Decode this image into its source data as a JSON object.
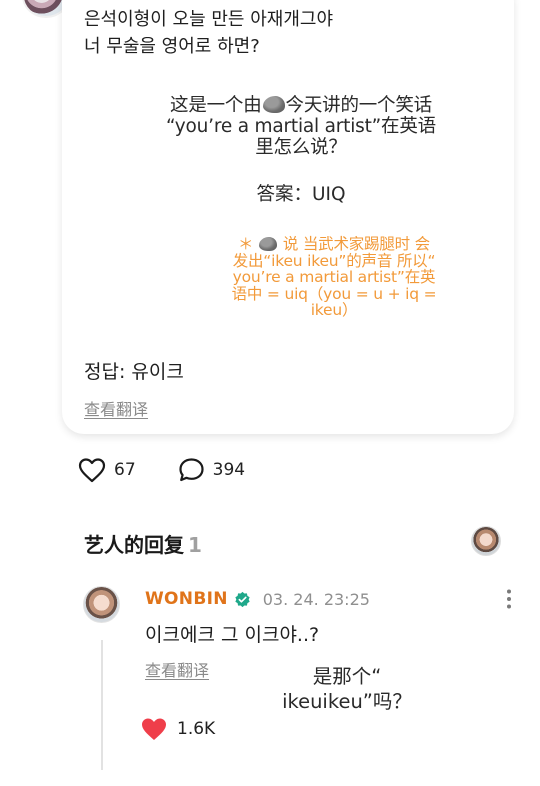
{
  "post": {
    "text_lines": [
      "은석이형이 오늘 만든 아재개그야",
      "너 무술을 영어로 하면?"
    ],
    "cn_question": {
      "before_rock": "这是一个由",
      "after_rock": "今天讲的一个笑话",
      "line2": "“you’re a martial artist”在英语",
      "line3": "里怎么说？"
    },
    "answer": "答案：UIQ",
    "note": {
      "star": "＊",
      "after_rock": "说 当武术家踢腿时 会",
      "line2": "发出“ikeu ikeu”的声音 所以“",
      "line3": "you’re a martial artist”在英",
      "line4": "语中 = uiq（you = u + iq =",
      "line5": "ikeu）"
    },
    "kr_answer": "정답: 유이크",
    "translate_label": "查看翻译",
    "rock_icon": "rock-emoji-icon"
  },
  "actions": {
    "likes": "67",
    "comments": "394"
  },
  "artist_replies": {
    "title": "艺人的回复",
    "count": "1"
  },
  "reply": {
    "author": "WONBIN",
    "timestamp": "03. 24. 23:25",
    "text": "이크에크 그 이크야..?",
    "translate_label": "查看翻译",
    "cn_line1": "是那个“",
    "cn_line2": "ikeuikeu”吗？",
    "likes": "1.6K"
  },
  "colors": {
    "accent_orange": "#e0741a",
    "note_orange": "#f29a3a",
    "verified_green": "#1fa88a",
    "heart_red": "#ef3e4a"
  }
}
